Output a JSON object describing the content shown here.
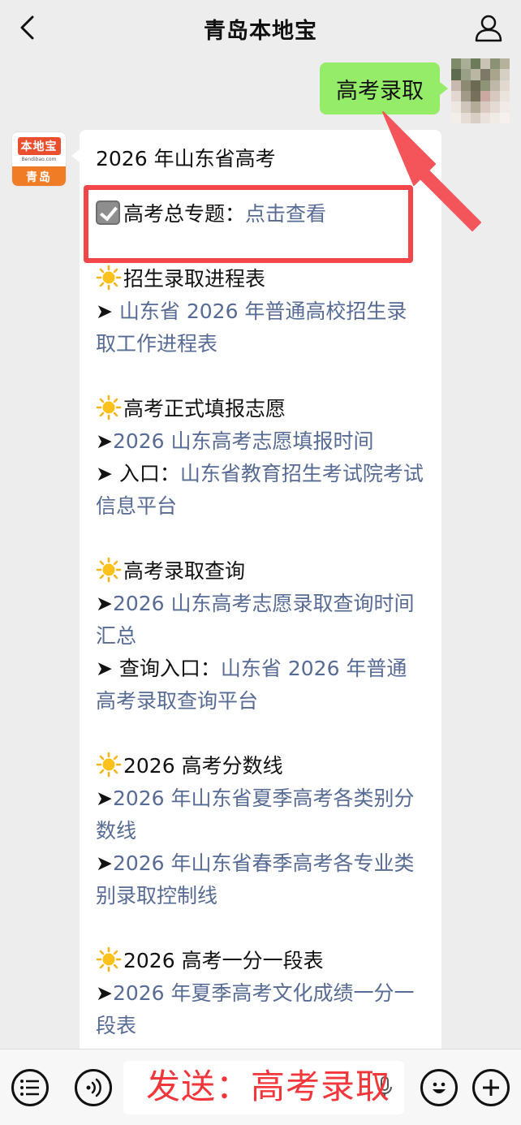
{
  "header": {
    "title": "青岛本地宝",
    "back_icon": "chevron-left-icon",
    "profile_icon": "person-icon"
  },
  "user_message": "高考录取",
  "bot_avatar": {
    "brand": "本地宝",
    "site": "Bendibao.com",
    "city": "青岛"
  },
  "bot_message": {
    "heading": "2026 年山东省高考",
    "topic": {
      "label": "高考总专题：",
      "link": "点击查看"
    },
    "sections": [
      {
        "title": "招生录取进程表",
        "lines": [
          {
            "prefix": "➤ ",
            "link": "山东省 2026 年普通高校招生录取工作进程表"
          }
        ]
      },
      {
        "title": "高考正式填报志愿",
        "lines": [
          {
            "prefix": "➤",
            "link": "2026 山东高考志愿填报时间"
          },
          {
            "prefix": "➤ 入口：",
            "link": "山东省教育招生考试院考试信息平台"
          }
        ]
      },
      {
        "title": "高考录取查询",
        "lines": [
          {
            "prefix": "➤",
            "link": "2026 山东高考志愿录取查询时间汇总"
          },
          {
            "prefix": "➤ 查询入口：",
            "link": "山东省 2026 年普通高考录取查询平台"
          }
        ]
      },
      {
        "title": "2026 高考分数线",
        "lines": [
          {
            "prefix": "➤",
            "link": "2026 年山东省夏季高考各类别分数线"
          },
          {
            "prefix": "➤",
            "link": "2026 年山东省春季高考各专业类别录取控制线"
          }
        ]
      },
      {
        "title": "2026 高考一分一段表",
        "lines": [
          {
            "prefix": "➤",
            "link": "2026 年夏季高考文化成绩一分一段表"
          }
        ]
      }
    ]
  },
  "bottom_bar": {
    "menu_icon": "list-menu-icon",
    "voice_icon": "voice-icon",
    "input_overlay_text": "发送：高考录取",
    "mic_icon": "microphone-icon",
    "emoji_icon": "emoji-icon",
    "plus_icon": "plus-icon"
  },
  "colors": {
    "accent_link": "#576b95",
    "user_bubble": "#95ec69",
    "annotation_red": "#f2363a"
  }
}
